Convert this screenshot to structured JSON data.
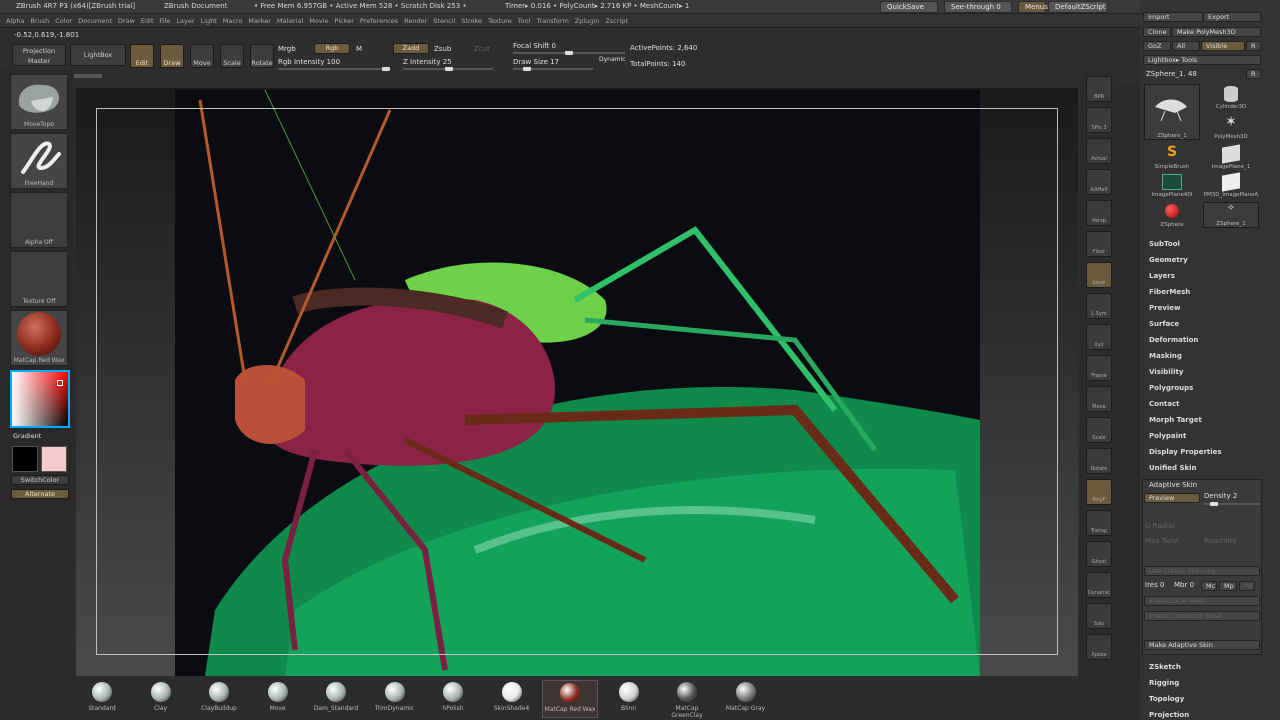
{
  "titlebar": {
    "app": "ZBrush 4R7 P3 (x64)[ZBrush trial]",
    "doc": "ZBrush Document",
    "free_mem": "• Free Mem 6.957GB • Active Mem 528 • Scratch Disk 253 •",
    "timer": "Timer▸ 0.016 • PolyCount▸ 2.716 KP • MeshCount▸ 1",
    "quicksave": "QuickSave",
    "see_through": "See-through  0",
    "menus": "Menus",
    "script": "DefaultZScript"
  },
  "menubar": [
    "Alpha",
    "Brush",
    "Color",
    "Document",
    "Draw",
    "Edit",
    "File",
    "Layer",
    "Light",
    "Macro",
    "Marker",
    "Material",
    "Movie",
    "Picker",
    "Preferences",
    "Render",
    "Stencil",
    "Stroke",
    "Texture",
    "Tool",
    "Transform",
    "Zplugin",
    "Zscript"
  ],
  "toolbar": {
    "coords": "-0.52,0.619,-1.801",
    "projection_master": "Projection Master",
    "lightbox": "LightBox",
    "edit": "Edit",
    "draw": "Draw",
    "move": "Move",
    "scale": "Scale",
    "rotate": "Rotate",
    "mrgb": "Mrgb",
    "rgb": "Rgb",
    "m": "M",
    "zadd": "Zadd",
    "zsub": "Zsub",
    "zcut": "Zcut",
    "rgb_intensity": "Rgb Intensity 100",
    "z_intensity": "Z Intensity 25",
    "focal_shift": "Focal Shift 0",
    "draw_size": "Draw Size 17",
    "dynamic": "Dynamic",
    "active_points": "ActivePoints: 2,640",
    "total_points": "TotalPoints: 140"
  },
  "leftshelf": {
    "brush": "MoveTopo",
    "stroke": "FreeHand",
    "alpha": "Alpha Off",
    "texture": "Texture Off",
    "material": "MatCap Red Wax",
    "gradient": "Gradient",
    "switchcolor": "SwitchColor",
    "alternate": "Alternate"
  },
  "rightshelf": [
    "BPR",
    "SPix 3",
    "Actual",
    "AAHalf",
    "Persp",
    "Floor",
    "Local",
    "L.Sym",
    "Xyz",
    "Frame",
    "Move",
    "Scale",
    "Rotate",
    "PolyF",
    "Transp",
    "Ghost",
    "Dynamic",
    "Solo",
    "Xpose"
  ],
  "panel": {
    "import": "Import",
    "export": "Export",
    "clone": "Clone",
    "make_polymesh": "Make PolyMesh3D",
    "goz": "GoZ",
    "all": "All",
    "visible": "Visible",
    "r": "R",
    "lightbox_tools": "Lightbox▸ Tools",
    "zsphere_val": "ZSphere_1. 48",
    "tools": [
      {
        "name": "ZSphere_1"
      },
      {
        "name": "Cylinder3D"
      },
      {
        "name": "PolyMesh3D"
      },
      {
        "name": "SimpleBrush"
      },
      {
        "name": "ImagePlane_1"
      },
      {
        "name": "ImagePlane40I"
      },
      {
        "name": "PM3D_ImagePlaneA"
      },
      {
        "name": "ZSphere"
      },
      {
        "name": "ZSphere_1"
      }
    ],
    "items": [
      "SubTool",
      "Geometry",
      "Layers",
      "FiberMesh",
      "Preview",
      "Surface",
      "Deformation",
      "Masking",
      "Visibility",
      "Polygroups",
      "Contact",
      "Morph Target",
      "Polypaint",
      "Display Properties",
      "Unified Skin"
    ],
    "adaptive_skin": "Adaptive Skin",
    "preview": "Preview",
    "density": "Density 2",
    "g_radial": "G Radial",
    "max_twist": "Max Twist",
    "proximity": "Proximity",
    "use_classic": "Use Classic Skinning",
    "ires": "Ires 0",
    "mbr": "Mbr 0",
    "mc": "Mc",
    "mp": "Mp",
    "pd": "Pd",
    "insert_local": "Insert Local Mesh",
    "insert_connector": "Insert Connector Mesh",
    "make_adaptive": "Make Adaptive Skin",
    "items2": [
      "ZSketch",
      "Rigging",
      "Topology",
      "Projection"
    ]
  },
  "brushes": [
    {
      "name": "Standard",
      "color": "#a8b4b0"
    },
    {
      "name": "Clay",
      "color": "#a8b4b0"
    },
    {
      "name": "ClayBuildup",
      "color": "#a8b4b0"
    },
    {
      "name": "Move",
      "color": "#a8b4b0"
    },
    {
      "name": "Dam_Standard",
      "color": "#a8b4b0"
    },
    {
      "name": "TrimDynamic",
      "color": "#a8b4b0"
    },
    {
      "name": "hPolish",
      "color": "#a8b4b0"
    },
    {
      "name": "SkinShade4",
      "color": "#e8e8e8"
    },
    {
      "name": "MatCap Red Wax",
      "color": "#8a2a1c"
    },
    {
      "name": "Blinn",
      "color": "#d0d0d0"
    },
    {
      "name": "MatCap GreenClay",
      "color": "#555"
    },
    {
      "name": "MatCap Gray",
      "color": "#777"
    }
  ]
}
